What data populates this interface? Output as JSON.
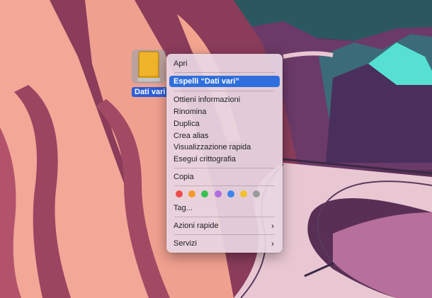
{
  "desktop": {
    "drive_label": "Dati vari"
  },
  "context_menu": {
    "items": [
      {
        "label": "Apri"
      },
      {
        "label": "Espelli “Dati vari”"
      },
      {
        "label": "Ottieni informazioni"
      },
      {
        "label": "Rinomina"
      },
      {
        "label": "Duplica"
      },
      {
        "label": "Crea alias"
      },
      {
        "label": "Visualizzazione rapida"
      },
      {
        "label": "Esegui crittografia"
      },
      {
        "label": "Copia"
      },
      {
        "label": "Tag..."
      },
      {
        "label": "Azioni rapide"
      },
      {
        "label": "Servizi"
      }
    ],
    "submenu_chevron": "›",
    "tag_colors": [
      "#ef4b4b",
      "#f59a2b",
      "#38c253",
      "#b06ee0",
      "#3d84f0",
      "#f2c12e",
      "#9a9a9a"
    ]
  },
  "colors": {
    "selection": "#2f6fdd",
    "menu_bg": "#e8d6e2"
  }
}
